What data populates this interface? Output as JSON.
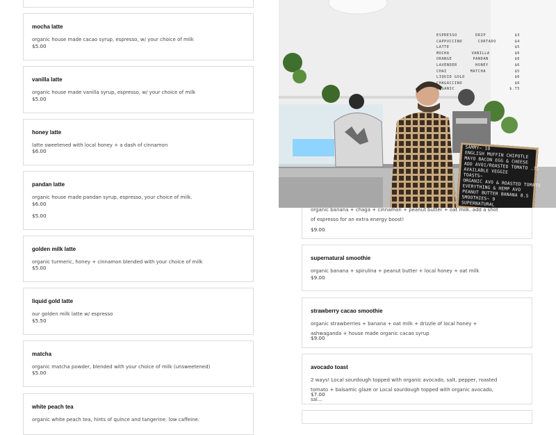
{
  "left_menu": [
    {
      "name": "",
      "description": "",
      "price": ""
    },
    {
      "name": "mocha latte",
      "description": "organic house made cacao syrup, espresso, w/ your choice of milk",
      "price": "$5.00"
    },
    {
      "name": "vanilla latte",
      "description": "organic house made vanilla syrup, espresso, w/ your choice of milk",
      "price": "$5.00"
    },
    {
      "name": "honey latte",
      "description": "latte sweetened with local honey + a dash of cinnamon",
      "price": "$6.00"
    },
    {
      "name": "pandan latte",
      "description": "organic house made pandan syrup, espresso, your choice of milk.",
      "price": "$6.00",
      "price2": "$5.00"
    },
    {
      "name": "golden milk latte",
      "description": "organic turmeric, honey + cinnamon blended with your choice of milk",
      "price": "$5.00"
    },
    {
      "name": "liquid gold latte",
      "description": "our golden milk latte w/ espresso",
      "price": "$5.50"
    },
    {
      "name": "matcha",
      "description": "organic matcha powder, blended with your choice of milk (unsweetened)",
      "price": "$5.00"
    },
    {
      "name": "white peach tea",
      "description": "organic white peach tea, hints of quince and tangerine. low caffeine.",
      "price": ""
    }
  ],
  "right_menu": [
    {
      "name": "",
      "description": "organic banana + chaga + cinnamon + peanut butter + oat milk. add a shot of espresso for an extra energy boost!",
      "price": "$9.00"
    },
    {
      "name": "supernatural smoothie",
      "description": "organic banana + spirulina + peanut butter + local honey + oat milk",
      "price": "$9.00"
    },
    {
      "name": "strawberry cacao smoothie",
      "description": "organic strawberries + banana + oat milk + drizzle of local honey + ashwaganda + house made organic cacao syrup",
      "price": "$9.00"
    },
    {
      "name": "avocado toast",
      "description": "2 ways! Local sourdough topped with organic avocado, salt, pepper, roasted tomato + balsamic glaze or Local sourdough topped with organic avocado, sal...",
      "price": "$7.00"
    },
    {
      "name": "",
      "description": "",
      "price": ""
    }
  ],
  "wall_board": [
    [
      "ESPRESSO",
      "DRIP",
      "$3"
    ],
    [
      "CAPPUCCINO",
      "CORTADO",
      "$4"
    ],
    [
      "LATTE",
      "",
      "$5"
    ],
    [
      "MOCHA",
      "VANILLA",
      "$6"
    ],
    [
      "ORANGE",
      "PANDAN",
      "$6"
    ],
    [
      "LAVENDER",
      "HONEY",
      "$6"
    ],
    [
      "CHAI",
      "MATCHA",
      "$5"
    ],
    [
      "LIQUID GOLD",
      "",
      "$6"
    ],
    [
      "CHAGACCINO",
      "",
      "$6"
    ],
    [
      "ORGANIC",
      "",
      "$.75"
    ]
  ],
  "letter_board": [
    "SAMMY~            10",
    "ENGLISH MUFFIN CHIPOTLE",
    "MAYO BACON EGG & CHEESE",
    "ADD AVO1/ROASTED TOMATO .75",
    "AVAILABLE VEGGIE",
    "TOASTS~",
    "ORGANIC AVO & ROASTED TOMATO",
    "EVERYTHING & HEMP AVO",
    "PEANUT BUTTER BANANA  8.5",
    "SMOOTHIES~ 9",
    "SUPERNATURAL"
  ]
}
